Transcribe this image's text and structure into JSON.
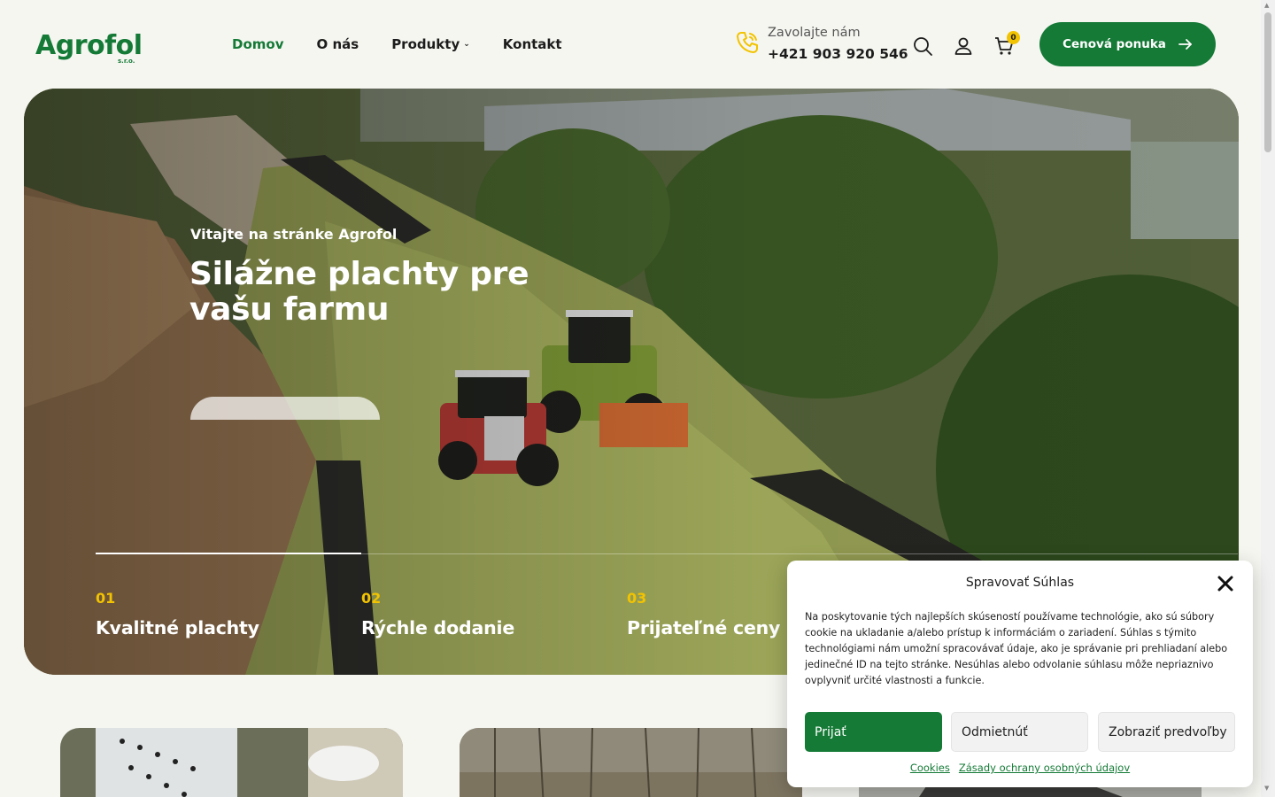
{
  "header": {
    "logo_text": "Agrofol",
    "logo_sub": "s.r.o.",
    "nav": [
      {
        "label": "Domov",
        "active": true
      },
      {
        "label": "O nás",
        "active": false
      },
      {
        "label": "Produkty",
        "active": false,
        "dropdown": true
      },
      {
        "label": "Kontakt",
        "active": false
      }
    ],
    "phone_label": "Zavolajte nám",
    "phone_number": "+421 903 920 546",
    "cart_count": "0",
    "cta_label": "Cenová ponuka",
    "icons": [
      "phone-icon",
      "search-icon",
      "user-icon",
      "cart-icon",
      "arrow-right-icon"
    ]
  },
  "hero": {
    "kicker": "Vitajte na stránke Agrofol",
    "title": "Silážne plachty pre vašu farmu",
    "features": [
      {
        "num": "01",
        "title": "Kvalitné plachty"
      },
      {
        "num": "02",
        "title": "Rýchle dodanie"
      },
      {
        "num": "03",
        "title": "Prijateľné ceny"
      }
    ]
  },
  "consent": {
    "title": "Spravovať Súhlas",
    "text": "Na poskytovanie tých najlepších skúseností používame technológie, ako sú súbory cookie na ukladanie a/alebo prístup k informáciám o zariadení. Súhlas s týmito technológiami nám umožní spracovávať údaje, ako je správanie pri prehliadaní alebo jedinečné ID na tejto stránke. Nesúhlas alebo odvolanie súhlasu môže nepriaznivo ovplyvniť určité vlastnosti a funkcie.",
    "accept_label": "Prijať",
    "deny_label": "Odmietnúť",
    "prefs_label": "Zobraziť predvoľby",
    "link_cookies": "Cookies",
    "link_privacy": "Zásady ochrany osobných údajov"
  },
  "colors": {
    "brand_green": "#147a36",
    "accent_yellow": "#f2c300",
    "background": "#f6f6f1"
  }
}
